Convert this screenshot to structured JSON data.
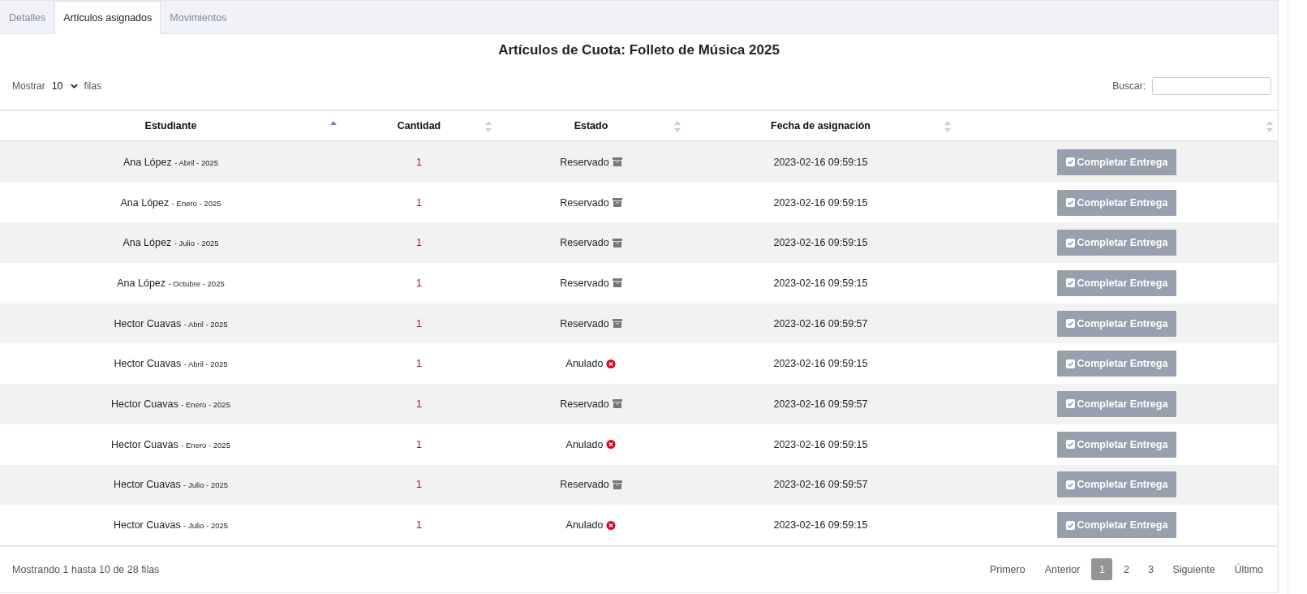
{
  "tabs": [
    {
      "label": "Detalles",
      "selected": false
    },
    {
      "label": "Artículos asignados",
      "selected": true
    },
    {
      "label": "Movimientos",
      "selected": false
    }
  ],
  "title": "Artículos de Cuota: Folleto de Música 2025",
  "length_control": {
    "prefix": "Mostrar",
    "value": "10",
    "suffix": "filas"
  },
  "search": {
    "label": "Buscar:"
  },
  "table": {
    "columns": [
      {
        "label": "Estudiante",
        "sorted": true
      },
      {
        "label": "Cantidad",
        "sorted": false
      },
      {
        "label": "Estado",
        "sorted": false
      },
      {
        "label": "Fecha de asignación",
        "sorted": false
      },
      {
        "sorted": false
      }
    ],
    "rows": [
      {
        "student": "Ana López",
        "period": "- Abril - 2025",
        "quantity": "1",
        "status": "Reservado",
        "cancelled": false,
        "date": "2023-02-16 09:59:15",
        "action": {
          "label": "Completar Entrega",
          "disabled": true
        }
      },
      {
        "student": "Ana López",
        "period": "- Enero - 2025",
        "quantity": "1",
        "status": "Reservado",
        "cancelled": false,
        "date": "2023-02-16 09:59:15",
        "action": {
          "label": "Completar Entrega",
          "disabled": true
        }
      },
      {
        "student": "Ana López",
        "period": "- Julio - 2025",
        "quantity": "1",
        "status": "Reservado",
        "cancelled": false,
        "date": "2023-02-16 09:59:15",
        "action": {
          "label": "Completar Entrega",
          "disabled": true
        }
      },
      {
        "student": "Ana López",
        "period": "- Octubre - 2025",
        "quantity": "1",
        "status": "Reservado",
        "cancelled": false,
        "date": "2023-02-16 09:59:15",
        "action": {
          "label": "Completar Entrega",
          "disabled": true
        }
      },
      {
        "student": "Hector Cuavas",
        "period": "- Abril - 2025",
        "quantity": "1",
        "status": "Reservado",
        "cancelled": false,
        "date": "2023-02-16 09:59:57",
        "action": {
          "label": "Completar Entrega",
          "disabled": true
        }
      },
      {
        "student": "Hector Cuavas",
        "period": "- Abril - 2025",
        "quantity": "1",
        "status": "Anulado",
        "cancelled": true,
        "date": "2023-02-16 09:59:15",
        "action": {
          "label": "Completar Entrega",
          "disabled": true
        }
      },
      {
        "student": "Hector Cuavas",
        "period": "- Enero - 2025",
        "quantity": "1",
        "status": "Reservado",
        "cancelled": false,
        "date": "2023-02-16 09:59:57",
        "action": {
          "label": "Completar Entrega",
          "disabled": true
        }
      },
      {
        "student": "Hector Cuavas",
        "period": "- Enero - 2025",
        "quantity": "1",
        "status": "Anulado",
        "cancelled": true,
        "date": "2023-02-16 09:59:15",
        "action": {
          "label": "Completar Entrega",
          "disabled": true
        }
      },
      {
        "student": "Hector Cuavas",
        "period": "- Julio - 2025",
        "quantity": "1",
        "status": "Reservado",
        "cancelled": false,
        "date": "2023-02-16 09:59:57",
        "action": {
          "label": "Completar Entrega",
          "disabled": true
        }
      },
      {
        "student": "Hector Cuavas",
        "period": "- Julio - 2025",
        "quantity": "1",
        "status": "Anulado",
        "cancelled": true,
        "date": "2023-02-16 09:59:15",
        "action": {
          "label": "Completar Entrega",
          "disabled": true
        }
      }
    ]
  },
  "footer": {
    "info": "Mostrando 1 hasta 10 de 28 filas",
    "pagination": [
      {
        "label": "Primero",
        "kind": "nav",
        "selected": false
      },
      {
        "label": "Anterior",
        "kind": "nav",
        "selected": false
      },
      {
        "label": "1",
        "kind": "page",
        "selected": true
      },
      {
        "label": "2",
        "kind": "page",
        "selected": false
      },
      {
        "label": "3",
        "kind": "page",
        "selected": false
      },
      {
        "label": "Siguiente",
        "kind": "nav",
        "selected": false
      },
      {
        "label": "Último",
        "kind": "nav",
        "selected": false
      }
    ]
  }
}
